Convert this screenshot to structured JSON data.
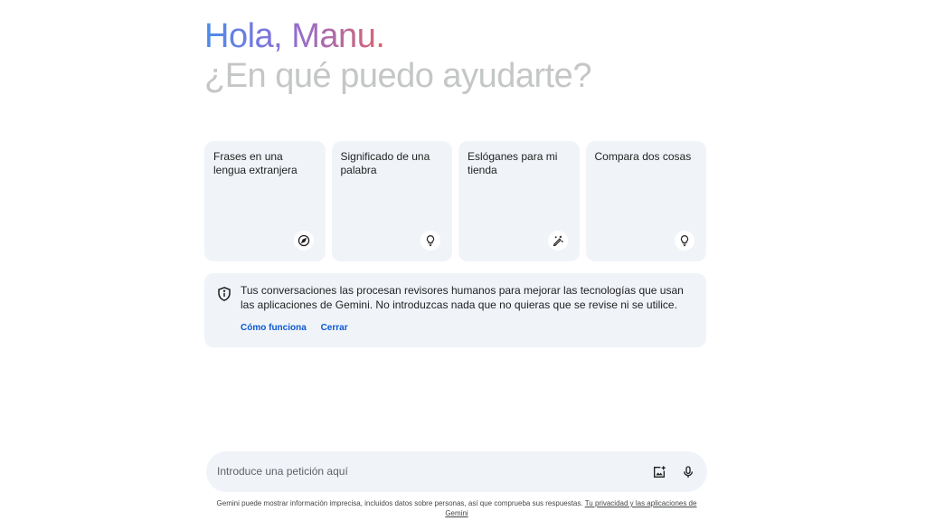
{
  "header": {
    "greeting": "Hola, Manu.",
    "subtitle": "¿En qué puedo ayudarte?"
  },
  "cards": [
    {
      "text": "Frases en una lengua extranjera",
      "icon": "compass-icon"
    },
    {
      "text": "Significado de una palabra",
      "icon": "lightbulb-icon"
    },
    {
      "text": "Eslóganes para mi tienda",
      "icon": "edit-sparkle-icon"
    },
    {
      "text": "Compara dos cosas",
      "icon": "lightbulb-icon"
    }
  ],
  "notice": {
    "text": "Tus conversaciones las procesan revisores humanos para mejorar las tecnologías que usan las aplicaciones de Gemini. No introduzcas nada que no quieras que se revise ni se utilice.",
    "how_it_works": "Cómo funciona",
    "close": "Cerrar",
    "icon": "shield-info-icon"
  },
  "prompt": {
    "placeholder": "Introduce una petición aquí",
    "image_button_icon": "add-image-icon",
    "mic_button_icon": "microphone-icon"
  },
  "footer": {
    "text": "Gemini puede mostrar información imprecisa, incluidos datos sobre personas, así que comprueba sus respuestas.",
    "link": "Tu privacidad y las aplicaciones de Gemini"
  },
  "colors": {
    "card_background": "#f0f4f9",
    "link_blue": "#0b57d0",
    "subtitle_gray": "#c4c7c5",
    "gradient_start": "#4b8de8",
    "gradient_end": "#d96570"
  }
}
